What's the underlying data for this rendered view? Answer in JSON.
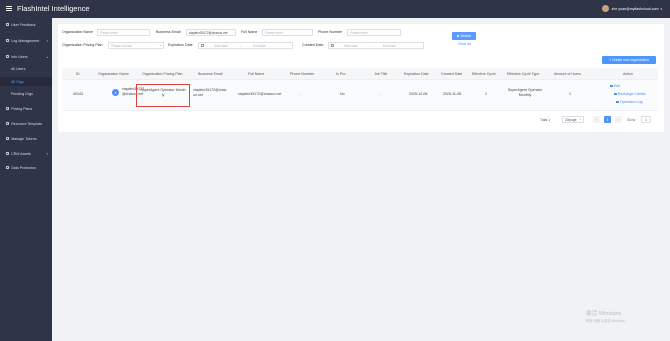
{
  "app": {
    "title": "FlashIntel Intelligence"
  },
  "user": {
    "email": "zhe yuan@myflashcloud.com"
  },
  "sidebar": {
    "items": [
      {
        "label": "User Feedback",
        "icon": "feedback-icon",
        "has_children": false
      },
      {
        "label": "Log Management",
        "icon": "log-icon",
        "has_children": true
      },
      {
        "label": "Info Users",
        "icon": "users-icon",
        "has_children": true
      }
    ],
    "subitems": [
      {
        "label": "All Users",
        "active": false
      },
      {
        "label": "All Orgs",
        "active": true
      },
      {
        "label": "Pending Orgs",
        "active": false
      }
    ],
    "items2": [
      {
        "label": "Pricing Plans",
        "icon": "pricing-icon",
        "has_children": false
      },
      {
        "label": "Resource Template",
        "icon": "template-icon",
        "has_children": false
      },
      {
        "label": "Manage Tokens",
        "icon": "token-icon",
        "has_children": false
      },
      {
        "label": "CRM Assets",
        "icon": "crm-icon",
        "has_children": true
      },
      {
        "label": "Data Protection",
        "icon": "shield-icon",
        "has_children": false
      }
    ]
  },
  "filters": {
    "org_name": {
      "label": "Organization Name",
      "placeholder": "Please enter"
    },
    "business_email": {
      "label": "Business Email",
      "value": "xiaplein39172@chacuo.net"
    },
    "full_name": {
      "label": "Full Name",
      "placeholder": "Please enter"
    },
    "phone_number": {
      "label": "Phone Number",
      "placeholder": "Please enter"
    },
    "pricing_plan": {
      "label": "Organization Pricing Plan",
      "placeholder": "Please choose"
    },
    "expiration_date": {
      "label": "Expiration Date",
      "start": "Start date",
      "separator": "-",
      "end": "End date"
    },
    "created_date": {
      "label": "Created Date",
      "start": "Start date",
      "separator": "-",
      "end": "End date"
    },
    "search_label": "Search",
    "clear_label": "Clear All"
  },
  "create_button": "+ Create new organization",
  "table": {
    "headers": [
      "ID",
      "Organization Name",
      "Organization Pricing Plan",
      "Business Email",
      "Full Name",
      "Phone Number",
      "Is Pro",
      "Job Title",
      "Expiration Date",
      "Created Date",
      "Effective Cycle",
      "Effective Cycle Type",
      "Amount of Users",
      "Action"
    ],
    "rows": [
      {
        "id": "90243",
        "org_initial": "X",
        "org_name_l1": "xiaplein39172",
        "org_name_l2": "@chacuo.net",
        "plan_l1": "SuperAgent Operator Month",
        "plan_l2": "ly",
        "email_l1": "xiaplein39172@chac",
        "email_l2": "uo.net",
        "full_name": "xiaplein39172@chacuo.net",
        "phone": "-",
        "is_pro": "No",
        "job_title": "-",
        "expiration": "2025-12-08",
        "created": "2025-11-08",
        "cycle": "1",
        "cycle_type_l1": "SuperAgent Operator",
        "cycle_type_l2": "Monthly",
        "users": "1",
        "actions": [
          "Edit",
          "Recharge Credits",
          "Operation Log"
        ]
      }
    ]
  },
  "pagination": {
    "total": "Total 1",
    "page_size": "20/page",
    "current_page": "1",
    "goto_label": "Go to",
    "goto_value": "1"
  },
  "watermark": {
    "line1": "激活 Windows",
    "line2": "转到\"设置\"以激活 Windows。"
  }
}
